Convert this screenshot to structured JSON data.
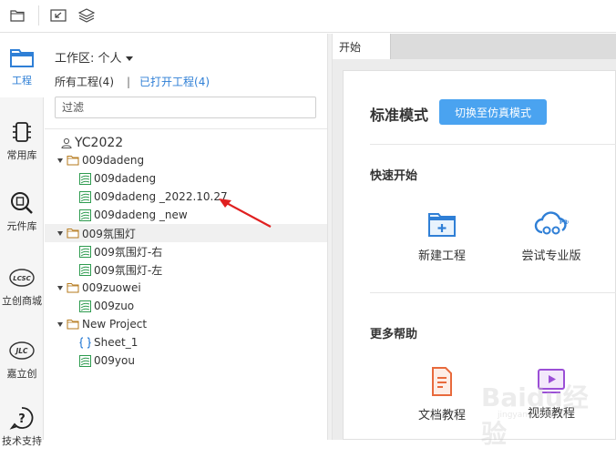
{
  "toolbar": {
    "icons": [
      "folder-icon",
      "import-icon",
      "layers-icon"
    ]
  },
  "nav": {
    "items": [
      {
        "label": "工程",
        "icon": "project-folder-icon",
        "active": true
      },
      {
        "label": "常用库",
        "icon": "chip-icon"
      },
      {
        "label": "元件库",
        "icon": "component-search-icon"
      },
      {
        "label": "立创商城",
        "icon": "lcsc-logo-icon"
      },
      {
        "label": "嘉立创",
        "icon": "jlc-logo-icon"
      },
      {
        "label": "技术支持",
        "icon": "question-icon"
      }
    ]
  },
  "project_panel": {
    "workspace_label": "工作区: 个人",
    "all_projects": "所有工程(4)",
    "separator": "|",
    "opened_projects": "已打开工程(4)",
    "filter_placeholder": "过滤",
    "tree": [
      {
        "label": "YC2022",
        "type": "user",
        "level": 0
      },
      {
        "label": "009dadeng",
        "type": "folder",
        "level": 1,
        "expanded": true
      },
      {
        "label": "009dadeng",
        "type": "schematic",
        "level": 2
      },
      {
        "label": "009dadeng _2022.10.27",
        "type": "schematic",
        "level": 2
      },
      {
        "label": "009dadeng _new",
        "type": "schematic",
        "level": 2
      },
      {
        "label": "009氛围灯",
        "type": "folder",
        "level": 1,
        "expanded": true,
        "highlighted": true
      },
      {
        "label": "009氛围灯-右",
        "type": "schematic",
        "level": 2
      },
      {
        "label": "009氛围灯-左",
        "type": "schematic",
        "level": 2
      },
      {
        "label": "009zuowei",
        "type": "folder",
        "level": 1,
        "expanded": true
      },
      {
        "label": "009zuo",
        "type": "schematic",
        "level": 2
      },
      {
        "label": "New Project",
        "type": "folder",
        "level": 1,
        "expanded": true
      },
      {
        "label": "Sheet_1",
        "type": "sheet",
        "level": 2
      },
      {
        "label": "009you",
        "type": "schematic",
        "level": 2
      }
    ]
  },
  "tabs": [
    {
      "label": "开始",
      "active": true
    }
  ],
  "start_page": {
    "mode_title": "标准模式",
    "switch_button": "切换至仿真模式",
    "quick_start_title": "快速开始",
    "quick_start": [
      {
        "label": "新建工程",
        "icon": "new-project-icon"
      },
      {
        "label": "尝试专业版",
        "icon": "cloud-pro-icon"
      }
    ],
    "more_help_title": "更多帮助",
    "help": [
      {
        "label": "文档教程",
        "icon": "document-tutorial-icon"
      },
      {
        "label": "视频教程",
        "icon": "video-tutorial-icon"
      }
    ]
  },
  "annotation": {
    "color": "#e02020",
    "icon": "red-arrow-icon"
  },
  "watermark": {
    "text": "Baidu经验",
    "url": "jingyan.baidu.com"
  },
  "colors": {
    "accent": "#2f7fd6",
    "button": "#4aa3f0",
    "schematic_icon": "#2e9b4f",
    "folder_icon": "#b5791b"
  }
}
